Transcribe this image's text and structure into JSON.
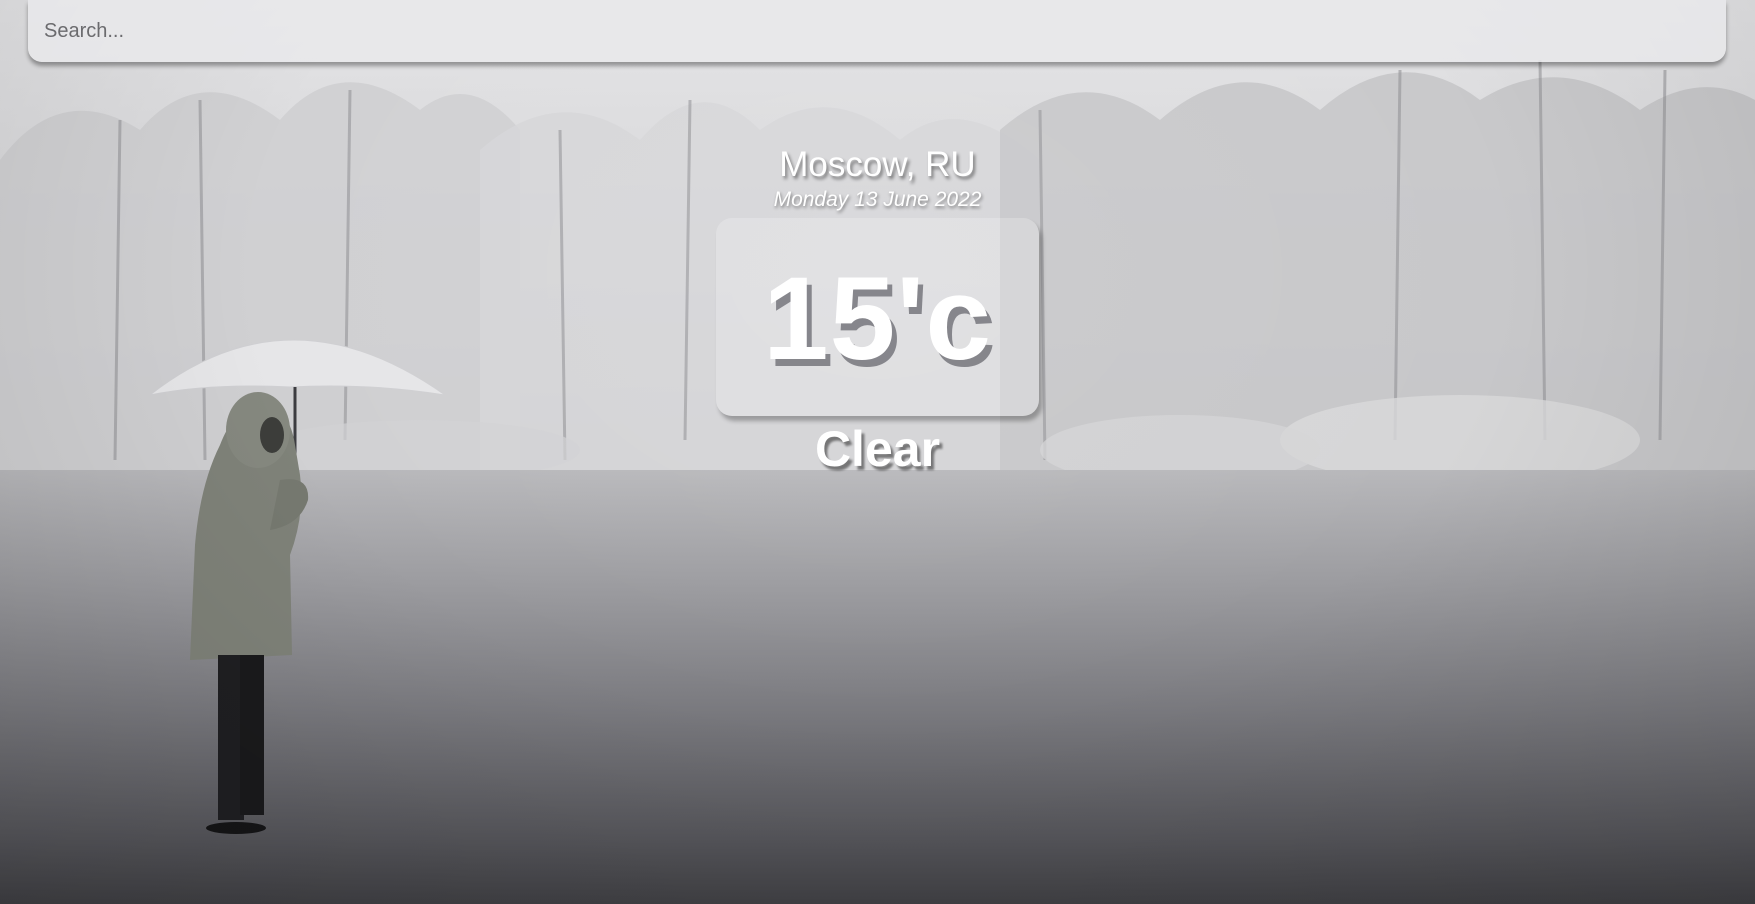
{
  "search": {
    "placeholder": "Search..."
  },
  "location": {
    "city": "Moscow, RU",
    "date": "Monday 13 June 2022"
  },
  "weather": {
    "temperature": "15'c",
    "condition": "Clear"
  },
  "background": {
    "scene": "snowy park with bare trees and a person holding an umbrella",
    "colors": {
      "sky": "#e4e4e6",
      "ground_dark": "#404044"
    }
  }
}
